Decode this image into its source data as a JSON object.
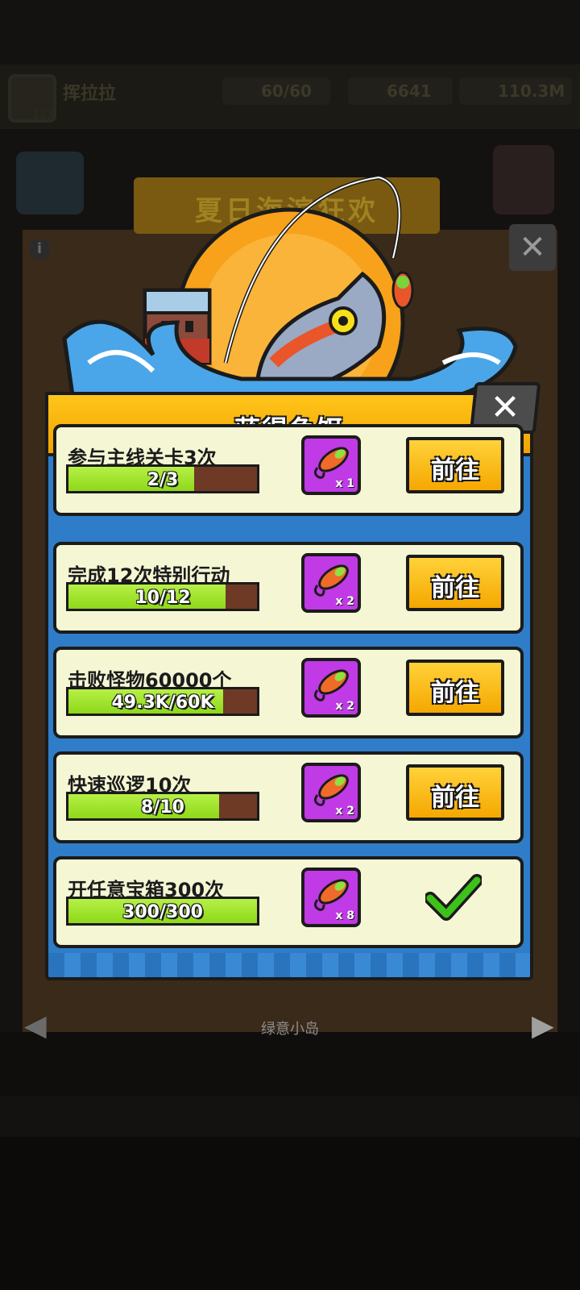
{
  "background": {
    "player_name": "挥拉拉",
    "player_sub": "123",
    "resources": [
      "60/60",
      "6641",
      "110.3M"
    ],
    "event_banner": "夏日海滨狂欢",
    "island": "绿意小岛"
  },
  "dialog": {
    "title": "获得鱼饵",
    "tasks": [
      {
        "label": "参与主线关卡3次",
        "progress_text": "2/3",
        "progress": 0.667,
        "reward_qty": "x 1",
        "action": "前往",
        "done": false
      },
      {
        "label": "完成12次特别行动",
        "progress_text": "10/12",
        "progress": 0.833,
        "reward_qty": "x 2",
        "action": "前往",
        "done": false
      },
      {
        "label": "击败怪物60000个",
        "progress_text": "49.3K/60K",
        "progress": 0.822,
        "reward_qty": "x 2",
        "action": "前往",
        "done": false
      },
      {
        "label": "快速巡逻10次",
        "progress_text": "8/10",
        "progress": 0.8,
        "reward_qty": "x 2",
        "action": "前往",
        "done": false
      },
      {
        "label": "开任意宝箱300次",
        "progress_text": "300/300",
        "progress": 1.0,
        "reward_qty": "x 8",
        "action": "",
        "done": true
      }
    ]
  },
  "colors": {
    "header": "#f7b500",
    "panel": "#2f7dc8",
    "row": "#f5f7d4",
    "reward_bg": "#c03ae6",
    "button": "#ffc21a",
    "check": "#3cc21a"
  },
  "icons": {
    "close": "close-icon",
    "reward": "fishing-lure-icon",
    "done": "checkmark-icon"
  }
}
